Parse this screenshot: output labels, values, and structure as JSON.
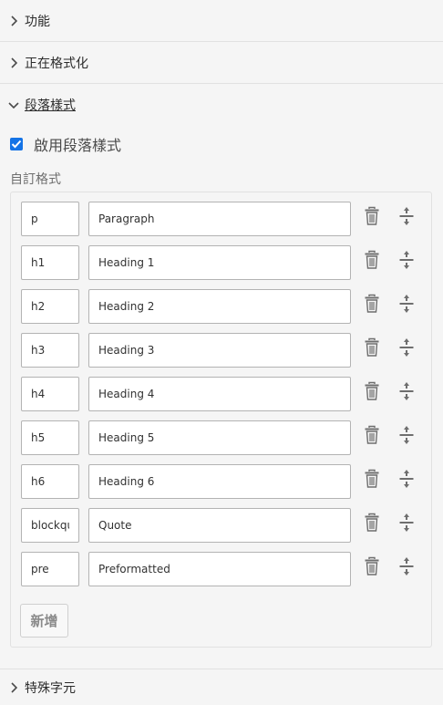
{
  "accordion": {
    "features": "功能",
    "formatting": "正在格式化",
    "paragraph_styles": "段落樣式",
    "special_chars": "特殊字元"
  },
  "enable_paragraph_styles": {
    "label": "啟用段落樣式",
    "checked": true
  },
  "custom_formats_label": "自訂格式",
  "formats": [
    {
      "tag": "p",
      "description": "Paragraph"
    },
    {
      "tag": "h1",
      "description": "Heading 1"
    },
    {
      "tag": "h2",
      "description": "Heading 2"
    },
    {
      "tag": "h3",
      "description": "Heading 3"
    },
    {
      "tag": "h4",
      "description": "Heading 4"
    },
    {
      "tag": "h5",
      "description": "Heading 5"
    },
    {
      "tag": "h6",
      "description": "Heading 6"
    },
    {
      "tag": "blockqu",
      "description": "Quote"
    },
    {
      "tag": "pre",
      "description": "Preformatted"
    }
  ],
  "add_button_label": "新增",
  "icons": {
    "chevron_right": "chevron-right-icon",
    "chevron_down": "chevron-down-icon",
    "check": "check-icon",
    "delete": "trash-icon",
    "move": "move-vertical-icon"
  },
  "colors": {
    "accent": "#1473e6",
    "icon": "#6e6e6e"
  }
}
